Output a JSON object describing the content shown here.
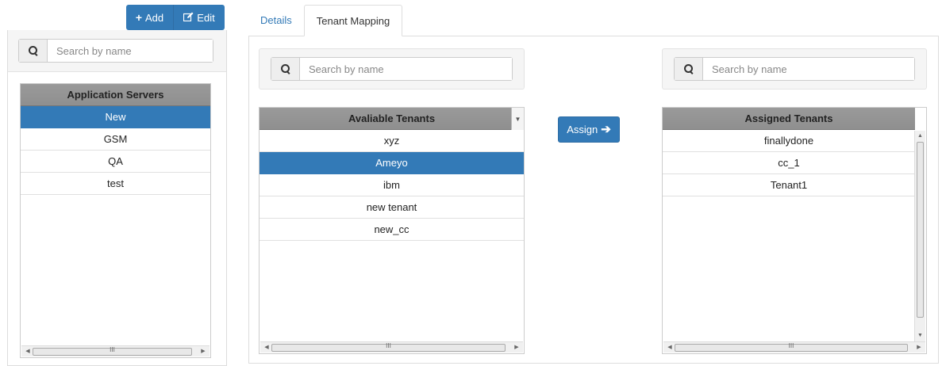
{
  "toolbar": {
    "add_label": "Add",
    "edit_label": "Edit"
  },
  "left": {
    "search_placeholder": "Search by name",
    "header": "Application Servers",
    "rows": [
      "New",
      "GSM",
      "QA",
      "test"
    ]
  },
  "tabs": {
    "details": "Details",
    "tenant_mapping": "Tenant Mapping"
  },
  "available": {
    "search_placeholder": "Search by name",
    "header": "Avaliable Tenants",
    "rows": [
      "xyz",
      "Ameyo",
      "ibm",
      "new tenant",
      "new_cc"
    ]
  },
  "assign": {
    "label": "Assign"
  },
  "assigned": {
    "search_placeholder": "Search by name",
    "header": "Assigned Tenants",
    "rows": [
      "finallydone",
      "cc_1",
      "Tenant1"
    ]
  },
  "icons": {
    "add": "plus-icon",
    "edit": "edit-icon",
    "search": "search-icon",
    "assign": "arrow-right-icon",
    "dropdown": "caret-down-icon"
  },
  "colors": {
    "primary": "#337ab7",
    "header_bg": "#959595",
    "panel_bg": "#f5f5f5"
  }
}
